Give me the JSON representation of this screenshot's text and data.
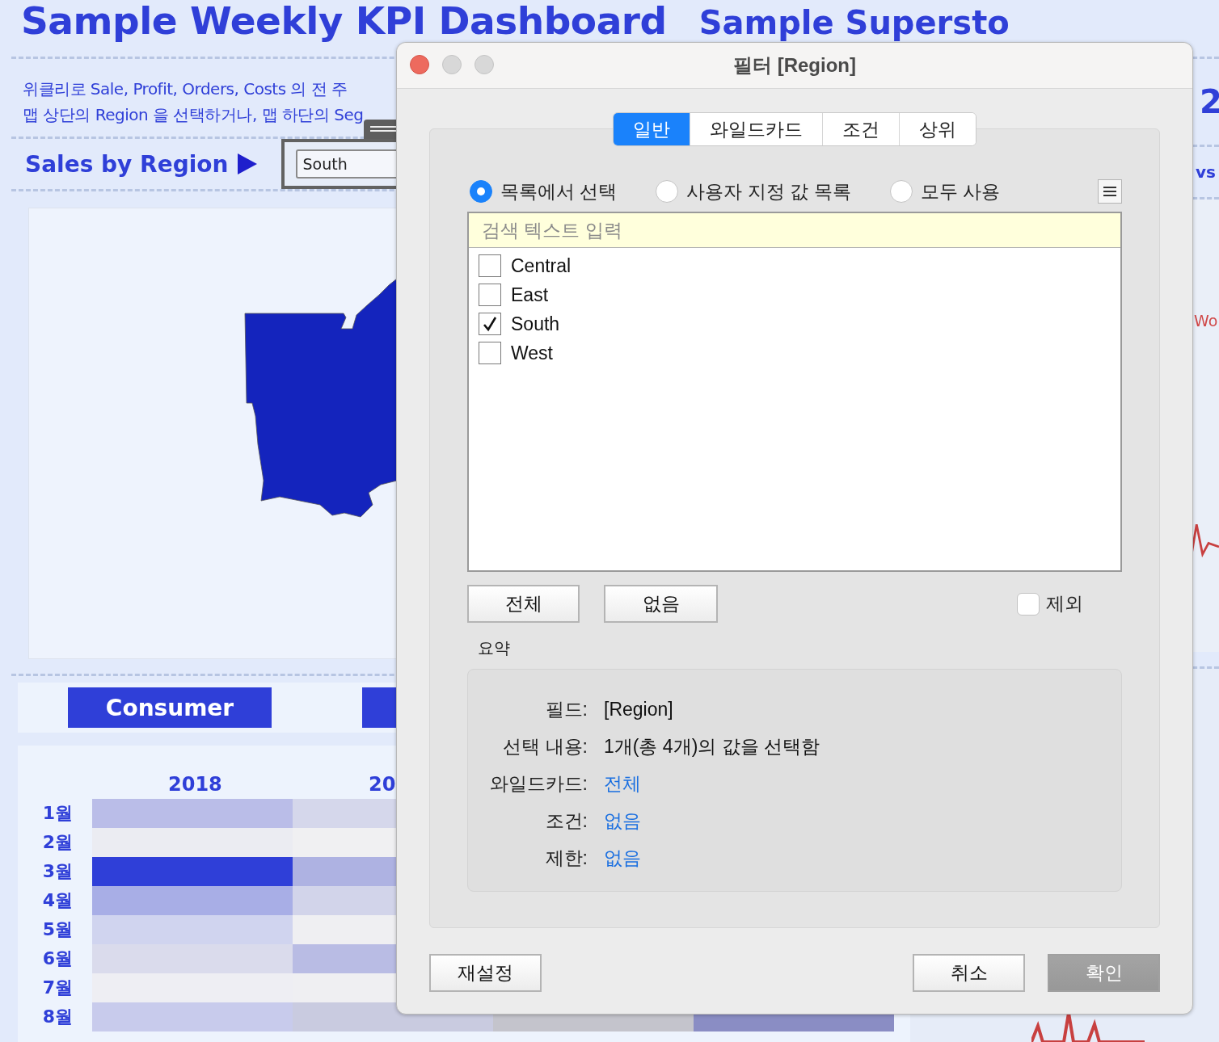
{
  "dashboard": {
    "title": "Sample Weekly KPI Dashboard",
    "subtitle": "Sample Supersto",
    "description": [
      "위클리로 Sale, Profit, Orders, Costs 의 전 주",
      "맵 상단의 Region 을 선택하거나, 맵 하단의 Seg"
    ],
    "map_section": {
      "title": "Sales by Region",
      "filter_value": "South"
    },
    "segment_buttons": [
      {
        "kind": "labeled",
        "label": "Consumer"
      },
      {
        "kind": "covered"
      }
    ],
    "heatmap": {
      "columns": [
        "2018",
        "20"
      ],
      "rows": [
        {
          "label": "1월",
          "cells": [
            {
              "color": "#babde8"
            },
            {
              "color": "#d5d7eb"
            }
          ]
        },
        {
          "label": "2월",
          "cells": [
            {
              "color": "#ebecf2"
            },
            {
              "color": "#f0f0f2"
            }
          ]
        },
        {
          "label": "3월",
          "cells": [
            {
              "color": "#2f3fd8"
            },
            {
              "color": "#aeb2e2"
            }
          ]
        },
        {
          "label": "4월",
          "cells": [
            {
              "color": "#a8aee6"
            },
            {
              "color": "#d2d4ea"
            }
          ]
        },
        {
          "label": "5월",
          "cells": [
            {
              "color": "#d0d4ef"
            },
            {
              "color": "#efeff2"
            }
          ]
        },
        {
          "label": "6월",
          "cells": [
            {
              "color": "#dadbec"
            },
            {
              "color": "#b9bce4"
            }
          ]
        },
        {
          "label": "7월",
          "cells": [
            {
              "color": "#eeeef3"
            },
            {
              "color": "#efeff2"
            }
          ]
        },
        {
          "label": "8월",
          "cells": [
            {
              "color": "#c8cbec"
            },
            {
              "color": "#c9cbe0"
            },
            {
              "color": "#c4c4cc"
            },
            {
              "color": "#8a8dc4"
            }
          ]
        }
      ]
    },
    "right_edge": {
      "big_number": "2",
      "label": "vs",
      "chart_label": "Wo"
    }
  },
  "filter_dialog": {
    "title": "필터 [Region]",
    "tabs": [
      {
        "label": "일반",
        "selected": true
      },
      {
        "label": "와일드카드",
        "selected": false
      },
      {
        "label": "조건",
        "selected": false
      },
      {
        "label": "상위",
        "selected": false
      }
    ],
    "modes": [
      {
        "label": "목록에서 선택",
        "selected": true
      },
      {
        "label": "사용자 지정 값 목록",
        "selected": false
      },
      {
        "label": "모두 사용",
        "selected": false
      }
    ],
    "search": {
      "placeholder": "검색 텍스트 입력"
    },
    "values": [
      {
        "label": "Central",
        "checked": false
      },
      {
        "label": "East",
        "checked": false
      },
      {
        "label": "South",
        "checked": true
      },
      {
        "label": "West",
        "checked": false
      }
    ],
    "select_buttons": [
      "전체",
      "없음"
    ],
    "exclude": {
      "label": "제외",
      "checked": false
    },
    "summary_title": "요약",
    "summary": [
      {
        "label": "필드:",
        "value": "[Region]",
        "kind": "text"
      },
      {
        "label": "선택 내용:",
        "value": "1개(총 4개)의 값을 선택함",
        "kind": "text"
      },
      {
        "label": "와일드카드:",
        "value": "전체",
        "kind": "link"
      },
      {
        "label": "조건:",
        "value": "없음",
        "kind": "link"
      },
      {
        "label": "제한:",
        "value": "없음",
        "kind": "link"
      }
    ],
    "footer_buttons": [
      {
        "label": "재설정",
        "disabled": false
      },
      {
        "label": "취소",
        "disabled": false
      },
      {
        "label": "확인",
        "disabled": true
      }
    ]
  }
}
